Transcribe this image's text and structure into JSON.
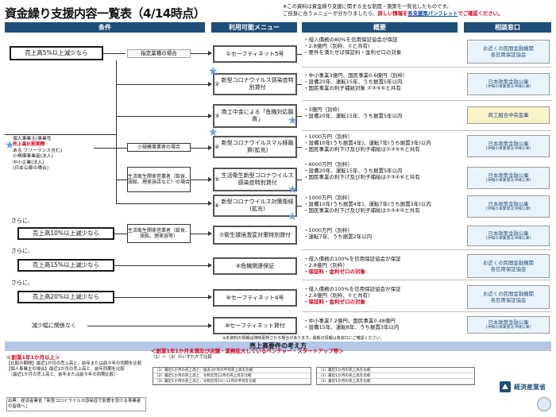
{
  "title": "資金繰り支援内容一覧表（4/14時点）",
  "note": {
    "line1": "※この資料は資金繰り支援に関する主な制度・施策を一覧化したものです。",
    "line2_pre": "ご自身に合うメニューが分かりましたら、",
    "line2_red": "詳しい情報を",
    "line2_link": "各支援策パンフレット",
    "line2_post": "でご確認ください。"
  },
  "headers": {
    "conditions": "条件",
    "menu": "利用可能メニュー",
    "overview": "概要",
    "consult": "相談窓口"
  },
  "conditions": {
    "c1": "売上高5%以上減少なら",
    "c1_sub": "指定業種の場合",
    "c3_left_lines": [
      "個人事業主(事業性",
      "ある フリーランス含む)",
      "小規模事業者(法人)",
      "中小企業(法人)",
      "(日本公庫の場合)"
    ],
    "c3_highlight": "売上高比較期間",
    "sub_small": "小規模事業者の場合",
    "sub_mid": "生活衛生関係営業者（飲食、旅館、理美容店など）の場合",
    "c_more1": "さらに、",
    "c10": "売上高10%以上減少なら",
    "c10_sub": "生活衛生関係営業者（飲食、旅館、理美容等）",
    "c_more2": "さらに、",
    "c15": "売上高15%以上減少なら",
    "c_more3": "さらに、",
    "c20": "売上高20%以上減少なら",
    "c_none": "減少幅に関係なく"
  },
  "menus": [
    {
      "num": "①",
      "label": "セーフティネット5号"
    },
    {
      "num": "②",
      "label": "新型コロナウイルス感染症特別貸付"
    },
    {
      "num": "③",
      "label": "商工中金による「危機対応融資」"
    },
    {
      "num": "④",
      "label": "新型コロナウイルスマル経融資(拡充)"
    },
    {
      "num": "⑤",
      "label": "生活衛生新型コロナウイルス感染症特別貸付"
    },
    {
      "num": "⑥",
      "label": "新型コロナウイルス対策衛経(拡充)"
    },
    {
      "num": "⑦",
      "label": "衛生環境激変対策特別貸付"
    },
    {
      "num": "⑧",
      "label": "危機関連保証"
    },
    {
      "num": "⑨",
      "label": "セーフティネット4号"
    },
    {
      "num": "⑩",
      "label": "セーフティネット貸付"
    }
  ],
  "overview": [
    [
      "・借入債務の80%を信用保証協会が保証",
      "・2.8億円（別枠、①と共有）",
      "・要件を満たせば保証料・金利ゼロの対象"
    ],
    [
      "・中小事業3億円、国民事業0.6億円（別枠）",
      "・設備20年、運転15年、うち据置5年以内",
      "・国民事業の利子補給対象 ②③⑤⑥と共有"
    ],
    [
      "・3億円（別枠）",
      "・設備20年、運転15年、うち据置5年以内"
    ],
    [
      "・1000万円（別枠）",
      "・設備10年(うち据置4年)、運転7年(うち据置3年)以内",
      "・国民事業の利下げ及び利子補給は②③⑤⑥と共有"
    ],
    [
      "・6000万円（別枠）",
      "・設備20年、運転15年、うち据置5年以内",
      "・国民事業の利下げ及び利子補給は②③④⑥と共有"
    ],
    [
      "・1000万円（別枠）",
      "・設備10年(うち据置4年)、運転7年(うち据置3年)以内",
      "・国民事業の利下げ及び利子補給は②③④⑤と共有"
    ],
    [
      "・1000万円（別枠）",
      "・運転7年、うち据置2年以内"
    ],
    [
      "・借入債務の100%を信用保証協会が保証",
      "・2.8億円（別枠）",
      "・保証料・金利ゼロの対象"
    ],
    [
      "・借入債務の100%を信用保証協会が保証",
      "・2.8億円（別枠、①と共有）",
      "・保証料・金利ゼロの対象"
    ],
    [
      "・中小事業7.2億円、国民事業0.48億円",
      "・設備15年、運転8年、うち据置3年以内"
    ]
  ],
  "overview_red": {
    "r0": "保証料・金利ゼロ",
    "r7": "保証料・金利ゼロ",
    "r8": "保証料・金利ゼロ"
  },
  "consult": [
    {
      "main": "お近くの民間金融機関",
      "sub": "各信用保証協会"
    },
    {
      "main": "日本政策金融公庫",
      "sub": "(沖縄の事業者は沖縄公庫)"
    },
    {
      "main": "商工組合中央金庫",
      "sub": ""
    },
    {
      "main": "日本政策金融公庫",
      "sub": "(沖縄の事業者は沖縄公庫)"
    },
    {
      "main": "日本政策金融公庫",
      "sub": "(沖縄の事業者は沖縄公庫)"
    },
    {
      "main": "日本政策金融公庫",
      "sub": "(沖縄の事業者は沖縄公庫)"
    },
    {
      "main": "日本政策金融公庫",
      "sub": "(沖縄の事業者は沖縄公庫)"
    },
    {
      "main": "お近くの民間金融機関",
      "sub": "各信用保証協会"
    },
    {
      "main": "お近くの民間金融機関",
      "sub": "各信用保証協会"
    },
    {
      "main": "日本政策金融公庫",
      "sub": "(沖縄の事業者は沖縄公庫)"
    }
  ],
  "footnote": "※本資料の情報は随時更新される場合があります。最新の情報は各窓口にご確認ください。",
  "bottom": {
    "header": "売上高要件の考え方",
    "left_title": "＜創業1年1か月以上＞",
    "left_lines": [
      "【比較の期間】最近1か月の売上高と、前年または前々年の同期を比較",
      "【個人事業主の場合】最近1か月の売上高と、前年同期を比較",
      "　（最近1か月の売上高と、前年または前々年の同期比較）"
    ],
    "left_bottom": "出典：経済産業省「新型コロナウイルス感染症で影響を受ける事業者の皆様へ」",
    "mid_title": "＜創業1年1か月未満及び店舗・業務拡大しているベンチャー・スタートアップ等＞",
    "mid_sub": "（1）～（3）のいずれかで比較",
    "table_rows": [
      "（1）最近1か月の売上高と、過去3か月の平均売上高を比較",
      "（2）最近1か月の売上高と、令和元年12月の売上高を比較",
      "（3）最近1か月の売上高と、令和元年10～12月の平均を比較"
    ],
    "table_rows2": [
      "（1）最近1か月の売上高を比較",
      "（2）最近1か月の売上高を比較",
      "（3）最近1か月の売上高を比較"
    ],
    "logo": "経済産業省"
  }
}
